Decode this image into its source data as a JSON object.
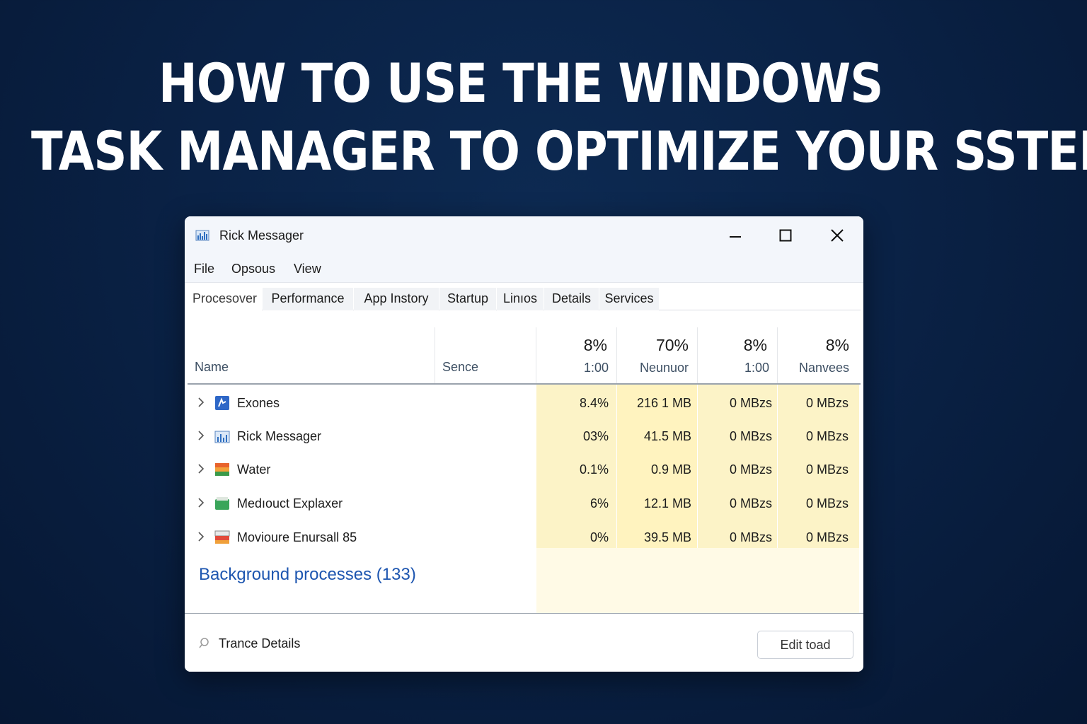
{
  "headline": {
    "line1": "HOW TO USE THE WINDOWS",
    "line2": "TASK MANAGER TO OPTIMIZE YOUR SSTEM"
  },
  "window": {
    "title": "Rick Messager",
    "icon": "task-manager-icon",
    "controls": [
      "minimize-icon",
      "maximize-icon",
      "close-icon"
    ]
  },
  "menu": [
    "File",
    "Opsous",
    "View"
  ],
  "tabs": [
    "Procesover",
    "Performance",
    "App Instory",
    "Startup",
    "Linıos",
    "Details",
    "Services"
  ],
  "active_tab": "Procesover",
  "table": {
    "name_header": "Name",
    "sence_header": "Sence",
    "columns": [
      {
        "pct": "8%",
        "sub": "1:00"
      },
      {
        "pct": "70%",
        "sub": "Neunuor"
      },
      {
        "pct": "8%",
        "sub": "1:00"
      },
      {
        "pct": "8%",
        "sub": "Nanvees"
      }
    ],
    "rows": [
      {
        "name": "Exones",
        "icon": "app-blue-icon",
        "cells": [
          "8.4%",
          "216 1 MB",
          "0 MBzs",
          "0 MBzs"
        ]
      },
      {
        "name": "Rick Messager",
        "icon": "task-manager-icon",
        "cells": [
          "03%",
          "41.5 MB",
          "0 MBzs",
          "0 MBzs"
        ]
      },
      {
        "name": "Water",
        "icon": "app-orange-icon",
        "cells": [
          "0.1%",
          "0.9 MB",
          "0 MBzs",
          "0 MBzs"
        ]
      },
      {
        "name": "Medıouct Explaxer",
        "icon": "app-green-icon",
        "cells": [
          "6%",
          "12.1 MB",
          "0 MBzs",
          "0 MBzs"
        ]
      },
      {
        "name": "Movioure Enursall 85",
        "icon": "app-red-icon",
        "cells": [
          "0%",
          "39.5 MB",
          "0 MBzs",
          "0 MBzs"
        ]
      }
    ],
    "group_label": "Background processes (133)"
  },
  "footer": {
    "details_label": "Trance Details",
    "button_label": "Edit toad"
  },
  "colors": {
    "background": "#0a2246",
    "heat": "#fcf3c7",
    "group": "#1e56b0"
  }
}
